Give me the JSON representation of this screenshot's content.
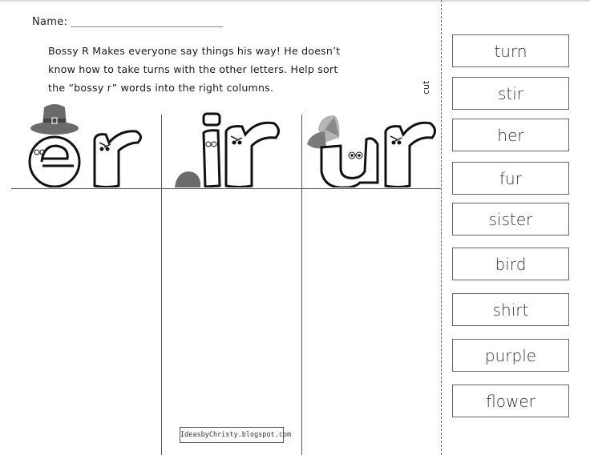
{
  "worksheet": {
    "name_label": "Name:",
    "intro_lines": [
      "Bossy R  Makes everyone say things his way!  He doesn’t",
      "know how to take turns with the other letters.  Help sort",
      "the “bossy r” words into the right columns."
    ],
    "cut_label": "cut",
    "columns": [
      {
        "label": "er",
        "hat": "pilgrim-hat"
      },
      {
        "label": "ir",
        "hat": "hard-hat"
      },
      {
        "label": "ur",
        "hat": "baseball-cap"
      }
    ],
    "credit": "IdeasbyChristy.blogspot.com"
  },
  "word_cards": [
    "turn",
    "stir",
    "her",
    "fur",
    "sister",
    "bird",
    "shirt",
    "purple",
    "flower"
  ],
  "colors": {
    "hat_dark": "#6b6b6b",
    "hat_light": "#b5b5b5",
    "line": "#555555"
  }
}
